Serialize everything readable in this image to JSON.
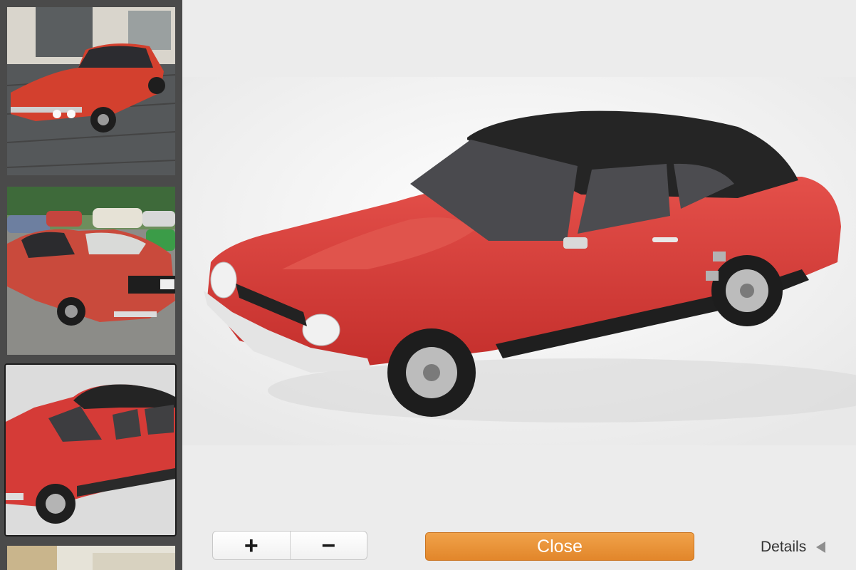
{
  "sidebar": {
    "thumbnails": [
      {
        "icon": "red-capri-front-photo"
      },
      {
        "icon": "red-capri-rear-photo"
      },
      {
        "icon": "red-capri-model-photo",
        "selected": true
      },
      {
        "icon": "partial-photo"
      }
    ]
  },
  "viewer": {
    "image": "red-ford-capri-black-roof-model"
  },
  "toolbar": {
    "zoom_in_label": "+",
    "zoom_out_label": "−",
    "close_label": "Close",
    "details_label": "Details"
  },
  "colors": {
    "accent": "#e8902f",
    "car_red": "#d93a36",
    "roof_black": "#222222"
  }
}
